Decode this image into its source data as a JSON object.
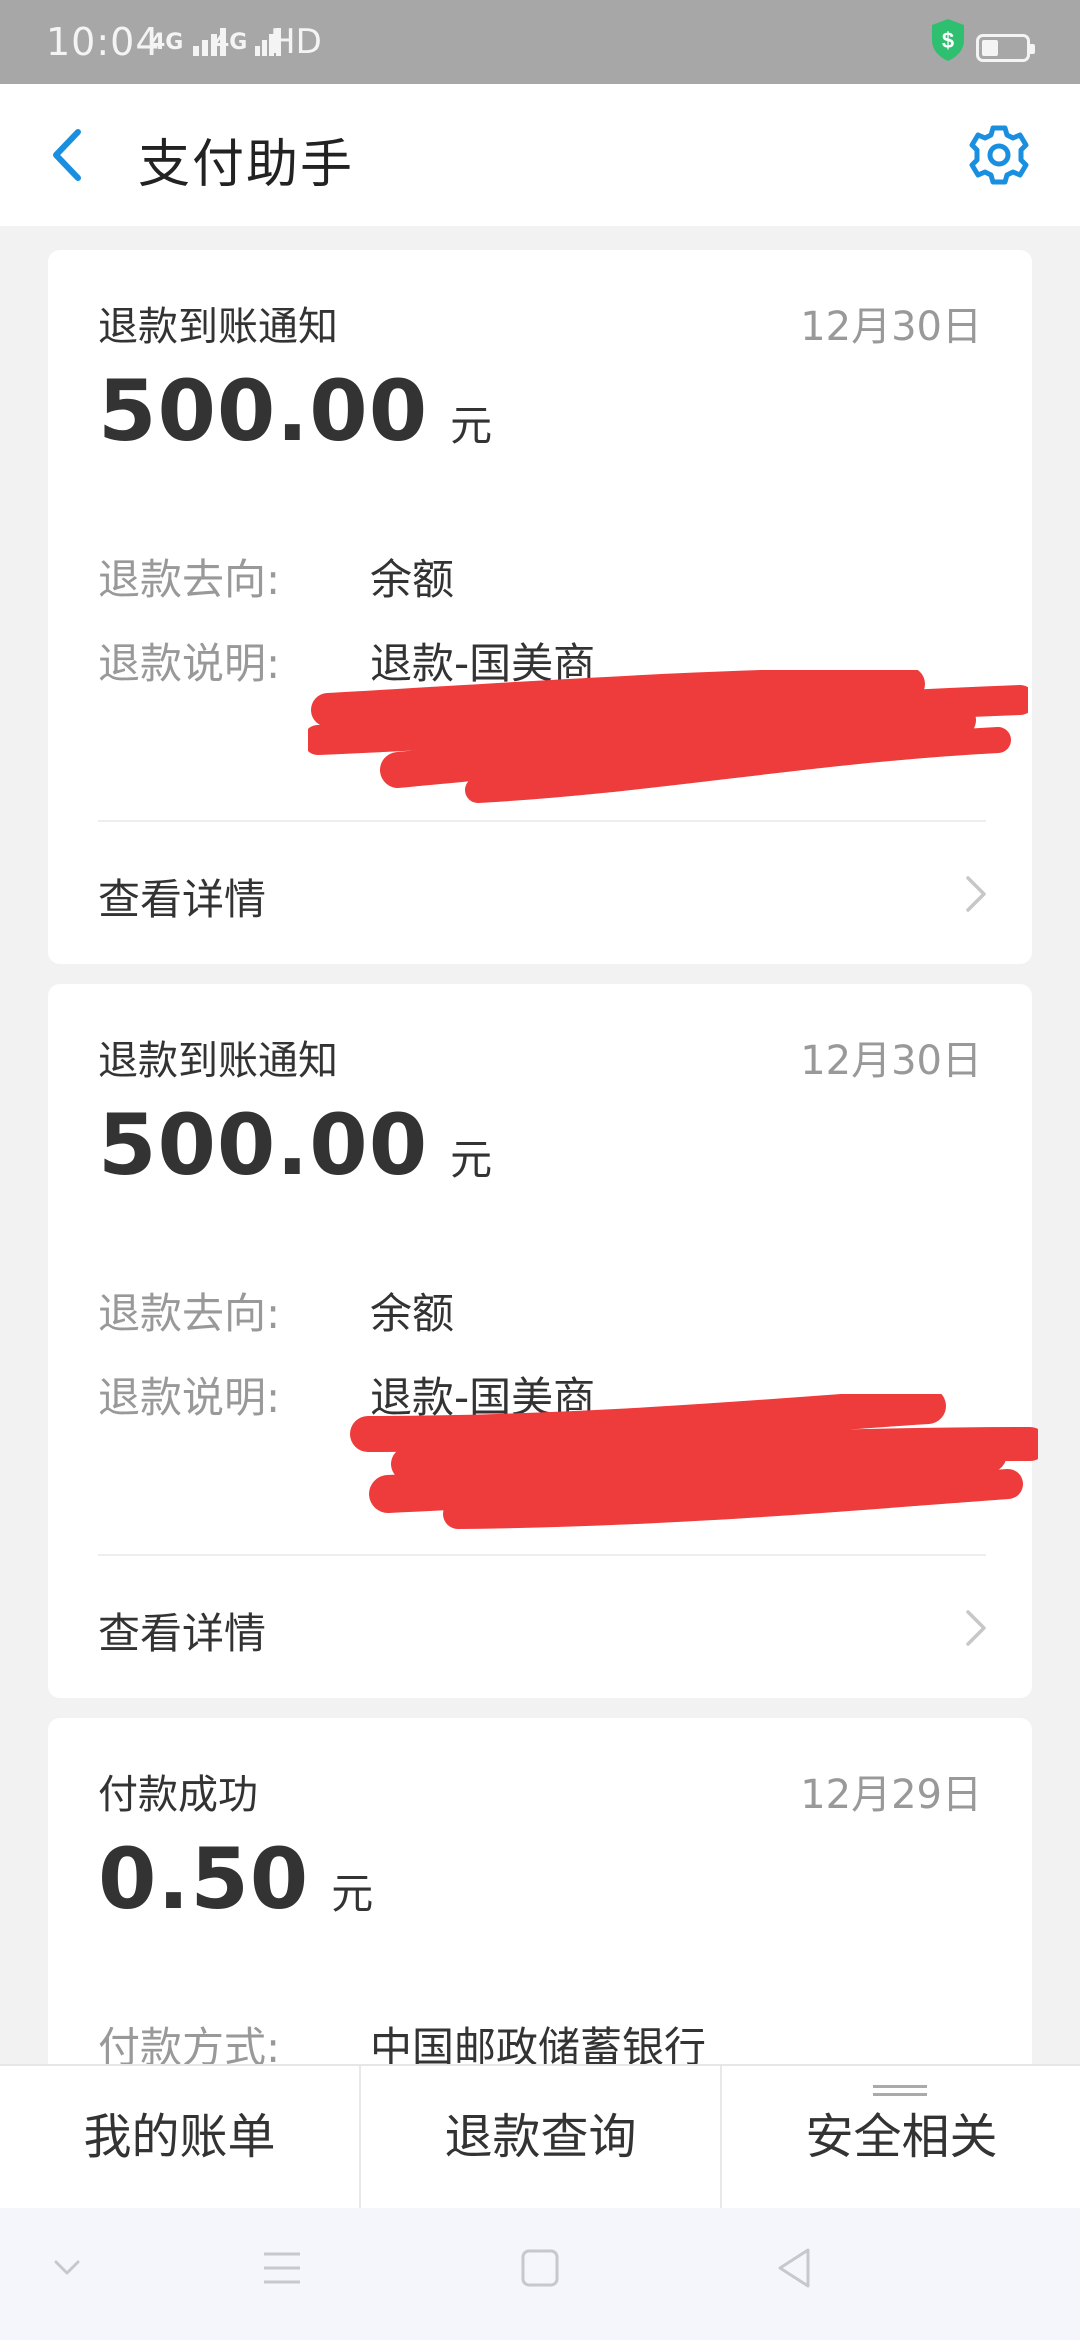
{
  "status_bar": {
    "time": "10:04",
    "signal1": "4G",
    "signal2": "4G",
    "hd": "HD"
  },
  "header": {
    "title": "支付助手"
  },
  "cards": [
    {
      "title": "退款到账通知",
      "date": "12月30日",
      "amount": "500.00",
      "currency": "元",
      "fields": [
        {
          "label": "退款去向:",
          "value": "余额"
        },
        {
          "label": "退款说明:",
          "value": "退款-国美商"
        }
      ],
      "details_label": "查看详情"
    },
    {
      "title": "退款到账通知",
      "date": "12月30日",
      "amount": "500.00",
      "currency": "元",
      "fields": [
        {
          "label": "退款去向:",
          "value": "余额"
        },
        {
          "label": "退款说明:",
          "value": "退款-国美商"
        }
      ],
      "details_label": "查看详情"
    },
    {
      "title": "付款成功",
      "date": "12月29日",
      "amount": "0.50",
      "currency": "元",
      "fields": [
        {
          "label": "付款方式:",
          "value": "中国邮政储蓄银行"
        }
      ]
    }
  ],
  "bottom_tabs": [
    {
      "label": "我的账单"
    },
    {
      "label": "退款查询"
    },
    {
      "label": "安全相关"
    }
  ],
  "colors": {
    "accent": "#1a8fe0",
    "redaction": "#ee3b3b",
    "status_bar": "#a7a7a7",
    "shield": "#2fbf71"
  },
  "icons": {
    "back": "back-arrow-icon",
    "settings": "gear-icon",
    "chevron": "chevron-right-icon"
  }
}
